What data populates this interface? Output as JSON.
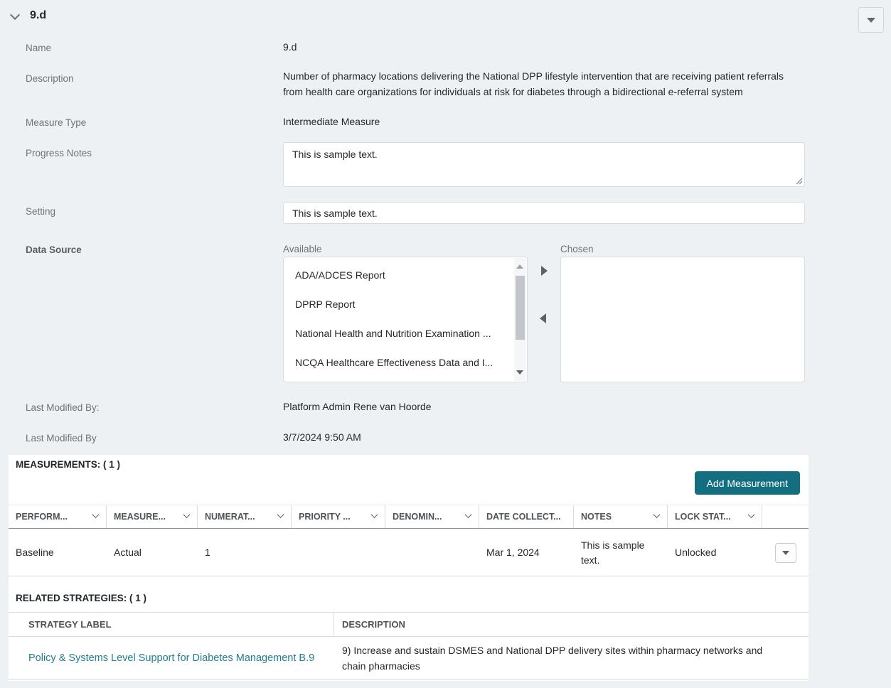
{
  "header": {
    "title": "9.d",
    "collapse_icon": "chevron-down-icon",
    "menu_icon": "caret-down-icon"
  },
  "fields": {
    "name": {
      "label": "Name",
      "value": "9.d"
    },
    "description": {
      "label": "Description",
      "value": "Number of pharmacy locations delivering the National DPP lifestyle intervention that are receiving patient referrals from health care organizations for individuals at risk for diabetes through a bidirectional e-referral system"
    },
    "measure_type": {
      "label": "Measure Type",
      "value": "Intermediate Measure"
    },
    "progress_notes": {
      "label": "Progress Notes",
      "value": "This is sample text."
    },
    "setting": {
      "label": "Setting",
      "value": "This is sample text."
    },
    "data_source": {
      "label": "Data Source",
      "available_label": "Available",
      "chosen_label": "Chosen",
      "available_items": [
        "ADA/ADCES Report",
        "DPRP Report",
        "National Health and Nutrition Examination ...",
        "NCQA Healthcare Effectiveness Data and I..."
      ],
      "chosen_items": []
    },
    "last_modified_by": {
      "label": "Last Modified By:",
      "value": "Platform Admin Rene van Hoorde"
    },
    "last_modified_date": {
      "label": "Last Modified By",
      "value": "3/7/2024 9:50 AM"
    }
  },
  "measurements": {
    "section_title": "MEASUREMENTS: ( 1 )",
    "add_button_label": "Add Measurement",
    "columns": [
      {
        "label": "PERFORM...",
        "menu": true
      },
      {
        "label": "MEASURE...",
        "menu": true
      },
      {
        "label": "NUMERAT...",
        "menu": true
      },
      {
        "label": "PRIORITY ...",
        "menu": true
      },
      {
        "label": "DENOMIN...",
        "menu": true
      },
      {
        "label": "DATE COLLECT...",
        "menu": false
      },
      {
        "label": "NOTES",
        "menu": true
      },
      {
        "label": "LOCK STAT...",
        "menu": true
      }
    ],
    "rows": [
      {
        "performance": "Baseline",
        "measure": "Actual",
        "numerator": "1",
        "priority": "",
        "denominator": "",
        "date_collected": "Mar 1, 2024",
        "notes": "This is sample text.",
        "lock_status": "Unlocked"
      }
    ]
  },
  "related_strategies": {
    "section_title": "RELATED STRATEGIES: ( 1 )",
    "columns": [
      {
        "label": "STRATEGY LABEL"
      },
      {
        "label": "DESCRIPTION"
      }
    ],
    "rows": [
      {
        "strategy_label": "Policy & Systems Level Support for Diabetes Management B.9",
        "description": "9) Increase and sustain DSMES and National DPP delivery sites within pharmacy networks and chain pharmacies"
      }
    ]
  },
  "colors": {
    "background": "#edf1f4",
    "panel": "#ffffff",
    "accent_teal": "#136f80",
    "link_teal": "#1e7e8e"
  }
}
